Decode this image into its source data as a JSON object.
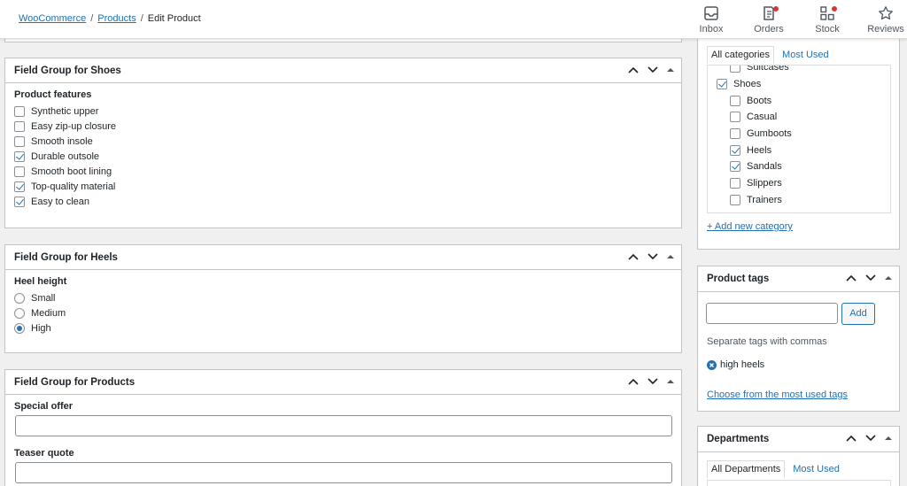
{
  "breadcrumb": {
    "woocommerce": "WooCommerce",
    "sep1": "/",
    "products": "Products",
    "sep2": "/",
    "current": "Edit Product"
  },
  "topbar": {
    "inbox": "Inbox",
    "orders": "Orders",
    "stock": "Stock",
    "reviews": "Reviews"
  },
  "shoes_group": {
    "title": "Field Group for Shoes",
    "section_label": "Product features",
    "items": [
      {
        "label": "Synthetic upper",
        "checked": false
      },
      {
        "label": "Easy zip-up closure",
        "checked": false
      },
      {
        "label": "Smooth insole",
        "checked": false
      },
      {
        "label": "Durable outsole",
        "checked": true
      },
      {
        "label": "Smooth boot lining",
        "checked": false
      },
      {
        "label": "Top-quality material",
        "checked": true
      },
      {
        "label": "Easy to clean",
        "checked": true
      }
    ]
  },
  "heels_group": {
    "title": "Field Group for Heels",
    "section_label": "Heel height",
    "options": [
      {
        "label": "Small",
        "selected": false
      },
      {
        "label": "Medium",
        "selected": false
      },
      {
        "label": "High",
        "selected": true
      }
    ]
  },
  "products_group": {
    "title": "Field Group for Products",
    "special_offer_label": "Special offer",
    "special_offer_value": "",
    "teaser_quote_label": "Teaser quote",
    "teaser_quote_value": ""
  },
  "categories": {
    "tab_all": "All categories",
    "tab_most_used": "Most Used",
    "items": [
      {
        "label": "Suitcases",
        "checked": false,
        "child": true
      },
      {
        "label": "Shoes",
        "checked": true,
        "child": false
      },
      {
        "label": "Boots",
        "checked": false,
        "child": true
      },
      {
        "label": "Casual",
        "checked": false,
        "child": true
      },
      {
        "label": "Gumboots",
        "checked": false,
        "child": true
      },
      {
        "label": "Heels",
        "checked": true,
        "child": true
      },
      {
        "label": "Sandals",
        "checked": true,
        "child": true
      },
      {
        "label": "Slippers",
        "checked": false,
        "child": true
      },
      {
        "label": "Trainers",
        "checked": false,
        "child": true
      }
    ],
    "add_new": "+ Add new category"
  },
  "tags": {
    "title": "Product tags",
    "input_value": "",
    "add_label": "Add",
    "hint": "Separate tags with commas",
    "tag_list": [
      "high heels"
    ],
    "choose_link": "Choose from the most used tags"
  },
  "departments": {
    "title": "Departments",
    "tab_all": "All Departments",
    "tab_most_used": "Most Used"
  },
  "colors": {
    "accent": "#2271b1",
    "notification": "#d63638",
    "border": "#c3c4c7",
    "background": "#f0f0f1"
  }
}
